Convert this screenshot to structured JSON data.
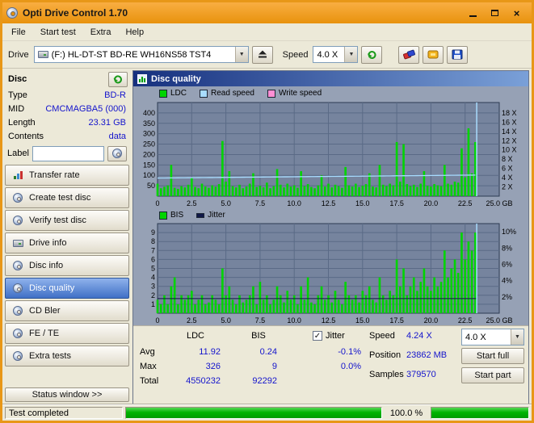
{
  "window": {
    "title": "Opti Drive Control 1.70"
  },
  "menu": [
    {
      "label": "File"
    },
    {
      "label": "Start test"
    },
    {
      "label": "Extra"
    },
    {
      "label": "Help"
    }
  ],
  "toolbar": {
    "drive_label": "Drive",
    "drive_value": "(F:)  HL-DT-ST BD-RE  WH16NS58 TST4",
    "speed_label": "Speed",
    "speed_value": "4.0 X"
  },
  "sidebar": {
    "section_title": "Disc",
    "info": [
      {
        "label": "Type",
        "value": "BD-R"
      },
      {
        "label": "MID",
        "value": "CMCMAGBA5 (000)"
      },
      {
        "label": "Length",
        "value": "23.31 GB"
      },
      {
        "label": "Contents",
        "value": "data"
      }
    ],
    "label_field": {
      "label": "Label",
      "value": ""
    },
    "buttons": [
      {
        "label": "Transfer rate"
      },
      {
        "label": "Create test disc"
      },
      {
        "label": "Verify test disc"
      },
      {
        "label": "Drive info"
      },
      {
        "label": "Disc info"
      },
      {
        "label": "Disc quality",
        "active": true
      },
      {
        "label": "CD Bler"
      },
      {
        "label": "FE / TE"
      },
      {
        "label": "Extra tests"
      }
    ],
    "status_window_label": "Status window >>"
  },
  "panel": {
    "title": "Disc quality",
    "legend_top": [
      {
        "label": "LDC",
        "color": "#00d400"
      },
      {
        "label": "Read speed",
        "color": "#a8dcff"
      },
      {
        "label": "Write speed",
        "color": "#ff8fd4"
      }
    ],
    "legend_bottom": [
      {
        "label": "BIS",
        "color": "#00d400"
      },
      {
        "label": "Jitter",
        "color": "#101848"
      }
    ]
  },
  "results": {
    "col_ldc": "LDC",
    "col_bis": "BIS",
    "jitter_checkbox": "Jitter",
    "rows": [
      {
        "label": "Avg",
        "ldc": "11.92",
        "bis": "0.24",
        "jitter": "-0.1%"
      },
      {
        "label": "Max",
        "ldc": "326",
        "bis": "9",
        "jitter": "0.0%"
      },
      {
        "label": "Total",
        "ldc": "4550232",
        "bis": "92292",
        "jitter": ""
      }
    ]
  },
  "controls": {
    "speed_label": "Speed",
    "speed_value": "4.24 X",
    "speed_select": "4.0 X",
    "position_label": "Position",
    "position_value": "23862 MB",
    "samples_label": "Samples",
    "samples_value": "379570",
    "start_full_label": "Start full",
    "start_part_label": "Start part"
  },
  "statusbar": {
    "status": "Test completed",
    "progress": "100.0 %"
  },
  "chart_data": [
    {
      "type": "bar",
      "title": "Disc quality - LDC with Read speed overlay",
      "xlabel": "GB",
      "x_max": 25,
      "dx": 0.25,
      "y_left_max": 450,
      "grid_step": 50,
      "left_ticks": [
        [
          400,
          "400"
        ],
        [
          350,
          "350"
        ],
        [
          300,
          "300"
        ],
        [
          250,
          "250"
        ],
        [
          200,
          "200"
        ],
        [
          150,
          "150"
        ],
        [
          100,
          "100"
        ],
        [
          50,
          "50"
        ]
      ],
      "right_max": 20.25,
      "right_ticks": [
        [
          18,
          "18 X"
        ],
        [
          16,
          "16 X"
        ],
        [
          14,
          "14 X"
        ],
        [
          12,
          "12 X"
        ],
        [
          10,
          "10 X"
        ],
        [
          8,
          "8 X"
        ],
        [
          6,
          "6 X"
        ],
        [
          4,
          "4 X"
        ],
        [
          2,
          "2 X"
        ]
      ],
      "x_ticks": [
        [
          0,
          "0"
        ],
        [
          2.5,
          "2.5"
        ],
        [
          5,
          "5.0"
        ],
        [
          7.5,
          "7.5"
        ],
        [
          10,
          "10.0"
        ],
        [
          12.5,
          "12.5"
        ],
        [
          15,
          "15.0"
        ],
        [
          17.5,
          "17.5"
        ],
        [
          20,
          "20.0"
        ],
        [
          22.5,
          "22.5"
        ],
        [
          25,
          "25.0 GB"
        ]
      ],
      "bar_color": "#00d400",
      "bars": [
        60,
        38,
        45,
        52,
        150,
        40,
        35,
        48,
        42,
        55,
        90,
        44,
        38,
        60,
        46,
        40,
        52,
        45,
        58,
        265,
        70,
        120,
        48,
        42,
        55,
        38,
        46,
        60,
        110,
        44,
        50,
        42,
        65,
        38,
        48,
        130,
        55,
        42,
        60,
        46,
        52,
        40,
        120,
        48,
        58,
        44,
        38,
        52,
        100,
        46,
        60,
        42,
        55,
        48,
        40,
        140,
        52,
        46,
        60,
        44,
        50,
        58,
        110,
        46,
        42,
        150,
        55,
        48,
        60,
        52,
        260,
        70,
        250,
        58,
        48,
        55,
        44,
        60,
        120,
        50,
        46,
        58,
        52,
        48,
        150,
        60,
        55,
        70,
        65,
        230,
        90,
        326,
        110,
        260
      ],
      "line": {
        "name": "Read speed",
        "color": "#a8dcff",
        "unit": "X",
        "start": 3.92,
        "end": 4.56
      },
      "end_spike_x": 23.35,
      "end_spike_color": "#a8dcff"
    },
    {
      "type": "bar",
      "title": "Disc quality - BIS with Jitter overlay",
      "xlabel": "GB",
      "x_max": 25,
      "dx": 0.25,
      "y_left_max": 10,
      "grid_step": 1,
      "left_ticks": [
        [
          9,
          "9"
        ],
        [
          8,
          "8"
        ],
        [
          7,
          "7"
        ],
        [
          6,
          "6"
        ],
        [
          5,
          "5"
        ],
        [
          4,
          "4"
        ],
        [
          3,
          "3"
        ],
        [
          2,
          "2"
        ],
        [
          1,
          "1"
        ]
      ],
      "right_max": 11,
      "right_ticks": [
        [
          10,
          "10%"
        ],
        [
          8,
          "8%"
        ],
        [
          6,
          "6%"
        ],
        [
          4,
          "4%"
        ],
        [
          2,
          "2%"
        ]
      ],
      "x_ticks": [
        [
          0,
          "0"
        ],
        [
          2.5,
          "2.5"
        ],
        [
          5,
          "5.0"
        ],
        [
          7.5,
          "7.5"
        ],
        [
          10,
          "10.0"
        ],
        [
          12.5,
          "12.5"
        ],
        [
          15,
          "15.0"
        ],
        [
          17.5,
          "17.5"
        ],
        [
          20,
          "20.0"
        ],
        [
          22.5,
          "22.5"
        ],
        [
          25,
          "25.0 GB"
        ]
      ],
      "bar_color": "#00d400",
      "bars": [
        1.5,
        1,
        2,
        1,
        3,
        4,
        1,
        2,
        1.5,
        2,
        2.5,
        1,
        1.5,
        2,
        1,
        1.2,
        2,
        1.5,
        1,
        5,
        2,
        3,
        1.5,
        1,
        2,
        1.2,
        1.5,
        2,
        3,
        1,
        3.5,
        1.5,
        2,
        1,
        1.5,
        3,
        2,
        1.2,
        2.5,
        1.5,
        2,
        1,
        3,
        1.5,
        4,
        1.2,
        1,
        2,
        3,
        1.5,
        2,
        1.2,
        2.5,
        1.5,
        1,
        3.5,
        2,
        1.5,
        2,
        1.2,
        2.5,
        2,
        3,
        1.5,
        1.2,
        4,
        2,
        1.5,
        2.5,
        2,
        6,
        3,
        5,
        2,
        3,
        4,
        2.5,
        3.5,
        5,
        3,
        2.5,
        4,
        3,
        3.5,
        7,
        4,
        5,
        6,
        4.5,
        9,
        6,
        8,
        7,
        9
      ],
      "jitter_line": {
        "value": 1.8,
        "color": "#0c1440"
      },
      "end_spike_x": 23.35,
      "end_spike_color": "#a8dcff"
    }
  ]
}
